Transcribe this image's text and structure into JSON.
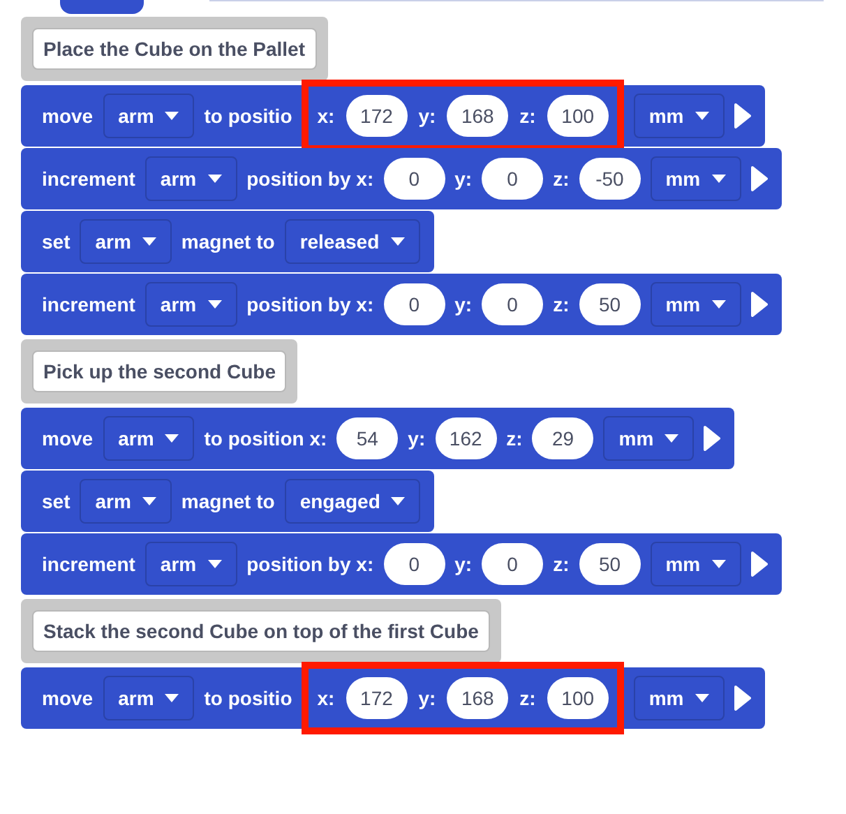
{
  "blocks": [
    {
      "kind": "comment",
      "text": "Place the Cube on the Pallet"
    },
    {
      "kind": "command",
      "parts": [
        {
          "kind": "label",
          "text": "move"
        },
        {
          "kind": "dropdown",
          "text": "arm"
        },
        {
          "kind": "label",
          "text": "to positio"
        },
        {
          "kind": "highlight",
          "parts": [
            {
              "kind": "label",
              "text": "x:"
            },
            {
              "kind": "number",
              "text": "172"
            },
            {
              "kind": "label",
              "text": "y:"
            },
            {
              "kind": "number",
              "text": "168"
            },
            {
              "kind": "label",
              "text": "z:"
            },
            {
              "kind": "number",
              "text": "100"
            }
          ]
        },
        {
          "kind": "dropdown",
          "text": "mm"
        },
        {
          "kind": "expand"
        }
      ]
    },
    {
      "kind": "command",
      "parts": [
        {
          "kind": "label",
          "text": "increment"
        },
        {
          "kind": "dropdown",
          "text": "arm"
        },
        {
          "kind": "label",
          "text": "position by x:"
        },
        {
          "kind": "number",
          "text": "0"
        },
        {
          "kind": "label",
          "text": "y:"
        },
        {
          "kind": "number",
          "text": "0"
        },
        {
          "kind": "label",
          "text": "z:"
        },
        {
          "kind": "number",
          "text": "-50"
        },
        {
          "kind": "dropdown",
          "text": "mm"
        },
        {
          "kind": "expand"
        }
      ]
    },
    {
      "kind": "command",
      "parts": [
        {
          "kind": "label",
          "text": "set"
        },
        {
          "kind": "dropdown",
          "text": "arm"
        },
        {
          "kind": "label",
          "text": "magnet to"
        },
        {
          "kind": "dropdown",
          "text": "released"
        }
      ]
    },
    {
      "kind": "command",
      "parts": [
        {
          "kind": "label",
          "text": "increment"
        },
        {
          "kind": "dropdown",
          "text": "arm"
        },
        {
          "kind": "label",
          "text": "position by x:"
        },
        {
          "kind": "number",
          "text": "0"
        },
        {
          "kind": "label",
          "text": "y:"
        },
        {
          "kind": "number",
          "text": "0"
        },
        {
          "kind": "label",
          "text": "z:"
        },
        {
          "kind": "number",
          "text": "50"
        },
        {
          "kind": "dropdown",
          "text": "mm"
        },
        {
          "kind": "expand"
        }
      ]
    },
    {
      "kind": "comment",
      "text": "Pick up the second Cube"
    },
    {
      "kind": "command",
      "parts": [
        {
          "kind": "label",
          "text": "move"
        },
        {
          "kind": "dropdown",
          "text": "arm"
        },
        {
          "kind": "label",
          "text": "to position x:"
        },
        {
          "kind": "number",
          "text": "54"
        },
        {
          "kind": "label",
          "text": "y:"
        },
        {
          "kind": "number",
          "text": "162"
        },
        {
          "kind": "label",
          "text": "z:"
        },
        {
          "kind": "number",
          "text": "29"
        },
        {
          "kind": "dropdown",
          "text": "mm"
        },
        {
          "kind": "expand"
        }
      ]
    },
    {
      "kind": "command",
      "parts": [
        {
          "kind": "label",
          "text": "set"
        },
        {
          "kind": "dropdown",
          "text": "arm"
        },
        {
          "kind": "label",
          "text": "magnet to"
        },
        {
          "kind": "dropdown",
          "text": "engaged"
        }
      ]
    },
    {
      "kind": "command",
      "parts": [
        {
          "kind": "label",
          "text": "increment"
        },
        {
          "kind": "dropdown",
          "text": "arm"
        },
        {
          "kind": "label",
          "text": "position by x:"
        },
        {
          "kind": "number",
          "text": "0"
        },
        {
          "kind": "label",
          "text": "y:"
        },
        {
          "kind": "number",
          "text": "0"
        },
        {
          "kind": "label",
          "text": "z:"
        },
        {
          "kind": "number",
          "text": "50"
        },
        {
          "kind": "dropdown",
          "text": "mm"
        },
        {
          "kind": "expand"
        }
      ]
    },
    {
      "kind": "comment",
      "text": "Stack the second Cube on top of the first Cube"
    },
    {
      "kind": "command",
      "parts": [
        {
          "kind": "label",
          "text": "move"
        },
        {
          "kind": "dropdown",
          "text": "arm"
        },
        {
          "kind": "label",
          "text": "to positio"
        },
        {
          "kind": "highlight",
          "parts": [
            {
              "kind": "label",
              "text": "x:"
            },
            {
              "kind": "number",
              "text": "172"
            },
            {
              "kind": "label",
              "text": "y:"
            },
            {
              "kind": "number",
              "text": "168"
            },
            {
              "kind": "label",
              "text": "z:"
            },
            {
              "kind": "number",
              "text": "100"
            }
          ]
        },
        {
          "kind": "dropdown",
          "text": "mm"
        },
        {
          "kind": "expand"
        }
      ]
    }
  ]
}
